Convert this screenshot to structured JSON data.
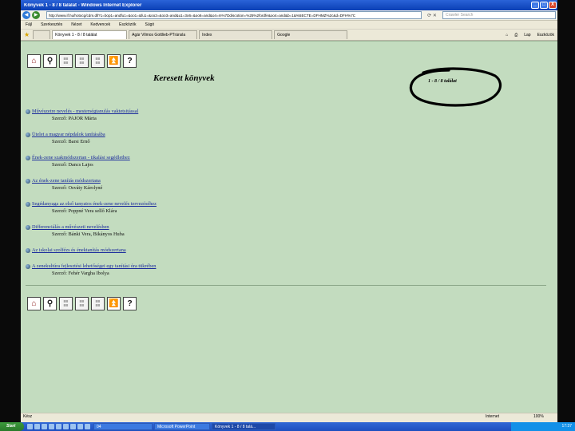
{
  "window": {
    "title": "Könyvek 1 - 8 / 8 találat - Windows Internet Explorer",
    "controls": [
      "_",
      "□",
      "X"
    ]
  },
  "address": {
    "url": "http://www.if.hu/hotocg/cdm.dll?1=bop1=andfu1=&oo1=&fu1=&oo2=&oo3=and&u1=3o6=&oo6=and&o4=m%7Ddiscotion=%25%2fordfe&oo4=and&b=1&%5ECTE=DFHMZ%2c&d=DFH%7C",
    "search_placeholder": "Crawler Search"
  },
  "menu": [
    "Fájl",
    "Szerkesztés",
    "Nézet",
    "Kedvencek",
    "Eszközök",
    "Súgó"
  ],
  "tabs": [
    {
      "label": ""
    },
    {
      "label": "Könyvek 1 - 8 / 8 találat"
    },
    {
      "label": "Agár Vilmos Gottlieb-PTránsla"
    },
    {
      "label": "Index"
    },
    {
      "label": "Google"
    }
  ],
  "tab_tools": [
    "Lap",
    "Eszközök"
  ],
  "toolbar_icons": [
    "home-icon",
    "search-icon",
    "list-icon",
    "list-icon",
    "list-icon",
    "top-icon",
    "help-icon"
  ],
  "page": {
    "heading": "Keresett könyvek",
    "result_count": "1 - 8 / 8 találat",
    "results": [
      {
        "title": "Művészetre nevelés - mesterségtanulás vaktetsitással",
        "author": "Szerző: PAJOR Márta"
      },
      {
        "title": "Ütelet a magyar népdalok tanításába",
        "author": "Szerző: Barsi Ernő"
      },
      {
        "title": "Ének-zene szakmódszertan - tikalási segédlethez",
        "author": "Szerző: Dancs Lajos"
      },
      {
        "title": "Az ének-zene tanítás módszertana",
        "author": "Szerző: Osváty Károlyné"
      },
      {
        "title": "Segédanyaga az első tanyatos ének-zene nevelés tervezéséhez",
        "author": "Szerző: Poppné Vera sellő Klára"
      },
      {
        "title": "Differenciálás a művészeti nevelésben",
        "author": "Szerző: Bánki Vera, Bikányos Huba"
      },
      {
        "title": "Az iskolai szolfézs és énektanítás módszertana",
        "author": ""
      },
      {
        "title": "A zenekultúra fejlesztési lehetőségei egy tanítási óra tükrében",
        "author": "Szerző: Fehér Vargha Ibolya"
      }
    ]
  },
  "status": {
    "left": "Kész",
    "zone": "Internet",
    "zoom": "100%"
  },
  "taskbar": {
    "start": "Start",
    "tasks": [
      "04",
      "Microsoft PowerPoint",
      "Könyvek 1 - 8 / 8 talá..."
    ],
    "clock": "17:37"
  },
  "colors": {
    "page_bg": "#c3dcbf",
    "link": "#1a2a9c",
    "titlebar": "#2a63d8"
  }
}
